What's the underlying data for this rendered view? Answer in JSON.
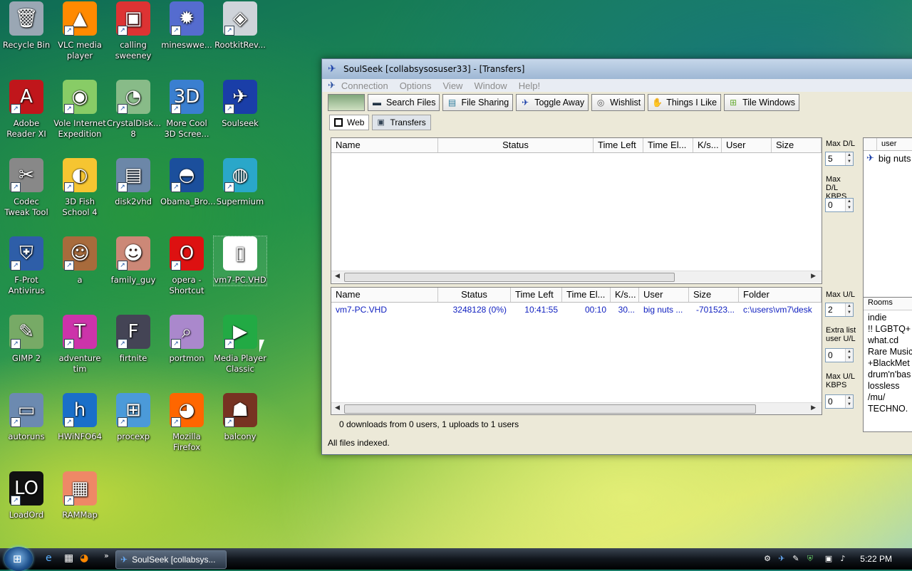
{
  "desktop": {
    "icons": [
      {
        "label": "Recycle Bin",
        "glyph": "🗑"
      },
      {
        "label": "VLC media player",
        "glyph": "▲"
      },
      {
        "label": "calling sweeney",
        "glyph": "▣"
      },
      {
        "label": "mineswwe...",
        "glyph": "✹"
      },
      {
        "label": "RootkitRev...",
        "glyph": "◈"
      },
      {
        "label": "Adobe Reader XI",
        "glyph": "A"
      },
      {
        "label": "Vole Internet Expedition",
        "glyph": "◉"
      },
      {
        "label": "CrystalDisk... 8",
        "glyph": "◔"
      },
      {
        "label": "More Cool 3D Scree...",
        "glyph": "3D"
      },
      {
        "label": "Soulseek",
        "glyph": "✈"
      },
      {
        "label": "Codec Tweak Tool",
        "glyph": "✂"
      },
      {
        "label": "3D Fish School 4",
        "glyph": "◐"
      },
      {
        "label": "disk2vhd",
        "glyph": "▤"
      },
      {
        "label": "Obama_Bro...",
        "glyph": "◓"
      },
      {
        "label": "Supermium",
        "glyph": "◍"
      },
      {
        "label": "F-Prot Antivirus",
        "glyph": "⛨"
      },
      {
        "label": "a",
        "glyph": "☺"
      },
      {
        "label": "family_guy",
        "glyph": "☻"
      },
      {
        "label": "opera - Shortcut",
        "glyph": "O"
      },
      {
        "label": "vm7-PC.VHD",
        "glyph": "▯"
      },
      {
        "label": "GIMP 2",
        "glyph": "✎"
      },
      {
        "label": "adventure tim",
        "glyph": "T"
      },
      {
        "label": "firtnite",
        "glyph": "F"
      },
      {
        "label": "portmon",
        "glyph": "⌕"
      },
      {
        "label": "Media Player Classic",
        "glyph": "▶"
      },
      {
        "label": "autoruns",
        "glyph": "▭"
      },
      {
        "label": "HWiNFO64",
        "glyph": "h"
      },
      {
        "label": "procexp",
        "glyph": "⊞"
      },
      {
        "label": "Mozilla Firefox",
        "glyph": "◕"
      },
      {
        "label": "balcony",
        "glyph": "☗"
      },
      {
        "label": "LoadOrd",
        "glyph": "LO"
      },
      {
        "label": "RAMMap",
        "glyph": "▦"
      }
    ]
  },
  "window": {
    "title": "SoulSeek [collabsysosuser33] - [Transfers]",
    "menu": [
      "Connection",
      "Options",
      "View",
      "Window",
      "Help!"
    ],
    "toolbar": [
      "Search Files",
      "File Sharing",
      "Toggle Away",
      "Wishlist",
      "Things I Like",
      "Tile Windows"
    ],
    "tabs": [
      "Web",
      "Transfers"
    ],
    "downloads": {
      "columns": [
        "Name",
        "Status",
        "Time Left",
        "Time El...",
        "K/s...",
        "User",
        "Size"
      ]
    },
    "uploads": {
      "columns": [
        "Name",
        "Status",
        "Time Left",
        "Time El...",
        "K/s...",
        "User",
        "Size",
        "Folder"
      ],
      "rows": [
        {
          "name": "vm7-PC.VHD",
          "status": "3248128 (0%)",
          "time_left": "10:41:55",
          "time_elapsed": "00:10",
          "kps": "30...",
          "user": "big nuts ...",
          "size": "-701523...",
          "folder": "c:\\users\\vm7\\desk"
        }
      ]
    },
    "summary": "0 downloads from 0 users, 1 uploads to 1 users",
    "status_bar": "All files indexed.",
    "limits": {
      "max_dl_label": "Max D/L",
      "max_dl_value": "5",
      "max_dl_kbps_label": "Max D/L KBPS",
      "max_dl_kbps_value": "0",
      "max_ul_label": "Max U/L",
      "max_ul_value": "2",
      "extra_list_label": "Extra list user U/L",
      "extra_list_value": "0",
      "max_ul_kbps_label": "Max U/L KBPS",
      "max_ul_kbps_value": "0"
    },
    "users_panel": {
      "header": "user",
      "items": [
        "big nuts"
      ]
    },
    "rooms_panel": {
      "header": "Rooms",
      "items": [
        "indie",
        "!! LGBTQ+",
        "what.cd",
        "Rare Music",
        "+BlackMet",
        "drum'n'bas",
        "lossless",
        "/mu/",
        "TECHNO."
      ]
    }
  },
  "taskbar": {
    "task_item": "SoulSeek [collabsys...",
    "clock": "5:22 PM"
  }
}
